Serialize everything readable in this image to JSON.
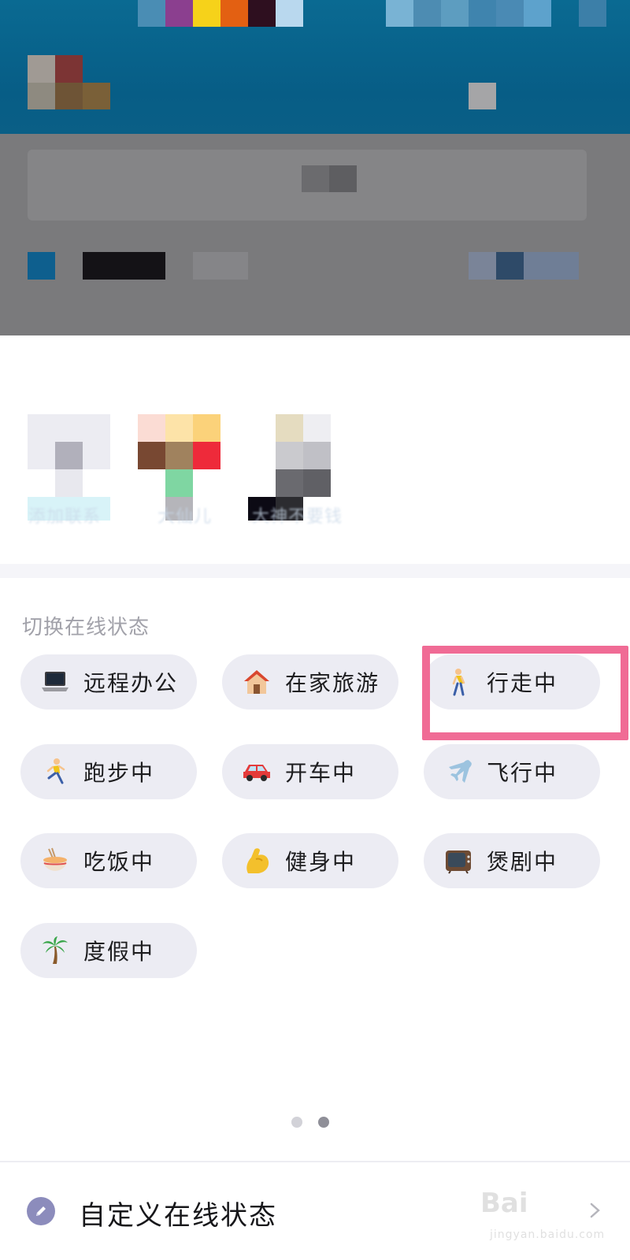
{
  "background": {
    "blurred_labels": [
      "添加联系",
      "大仙儿",
      "大神不要钱"
    ]
  },
  "status_sheet": {
    "title": "切换在线状态",
    "options": [
      {
        "icon": "laptop-icon",
        "label": "远程办公"
      },
      {
        "icon": "house-icon",
        "label": "在家旅游"
      },
      {
        "icon": "walking-person-icon",
        "label": "行走中",
        "highlighted": true
      },
      {
        "icon": "running-person-icon",
        "label": "跑步中"
      },
      {
        "icon": "car-icon",
        "label": "开车中"
      },
      {
        "icon": "airplane-icon",
        "label": "飞行中"
      },
      {
        "icon": "noodle-bowl-icon",
        "label": "吃饭中"
      },
      {
        "icon": "flexed-arm-icon",
        "label": "健身中"
      },
      {
        "icon": "television-icon",
        "label": "煲剧中"
      },
      {
        "icon": "palm-tree-icon",
        "label": "度假中"
      }
    ],
    "page_indicator": {
      "pages": 2,
      "current": 2
    },
    "custom_status_label": "自定义在线状态"
  },
  "colors": {
    "chip_bg": "#ececf3",
    "highlight": "#f06b95",
    "title_gray": "#a2a2aa",
    "dim_overlay": "#7a7a7c",
    "banner_blue": "#075d86"
  },
  "watermark": {
    "brand": "Bai",
    "sub": "jingyan.baidu.com"
  }
}
